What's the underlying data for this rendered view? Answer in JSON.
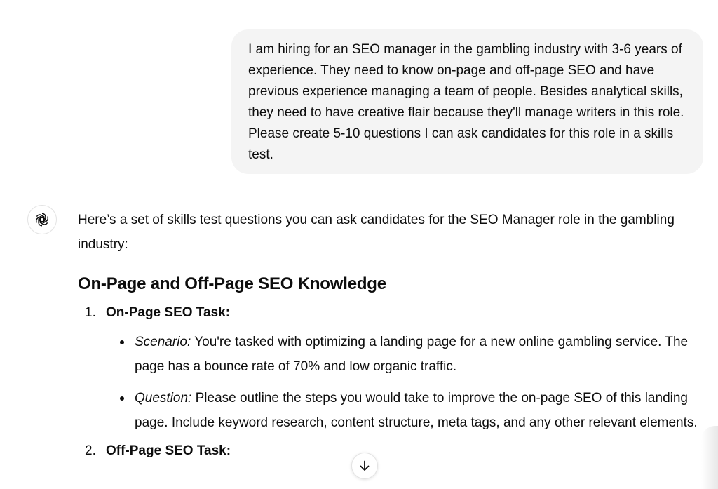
{
  "user_message": {
    "text": " I am hiring for an SEO manager in the gambling industry with 3-6 years of experience. They need to know on-page and off-page SEO and have previous experience managing a team of people. Besides analytical skills, they need to have creative flair because they'll manage writers in this role. Please create 5-10 questions I can ask candidates for this role in a skills test."
  },
  "assistant": {
    "avatar_icon": "openai-logo-icon",
    "intro": "Here’s a set of skills test questions you can ask candidates for the SEO Manager role in the gambling industry:",
    "section_heading": "On-Page and Off-Page SEO Knowledge",
    "questions": [
      {
        "number": "1.",
        "title": "On-Page SEO Task:",
        "details": [
          {
            "label": "Scenario:",
            "text": " You're tasked with optimizing a landing page for a new online gambling service. The page has a bounce rate of 70% and low organic traffic."
          },
          {
            "label": "Question:",
            "text": " Please outline the steps you would take to improve the on-page SEO of this landing page. Include keyword research, content structure, meta tags, and any other relevant elements."
          }
        ]
      },
      {
        "number": "2.",
        "title": "Off-Page SEO Task:"
      }
    ]
  },
  "scroll_button": {
    "icon": "arrow-down-icon"
  }
}
